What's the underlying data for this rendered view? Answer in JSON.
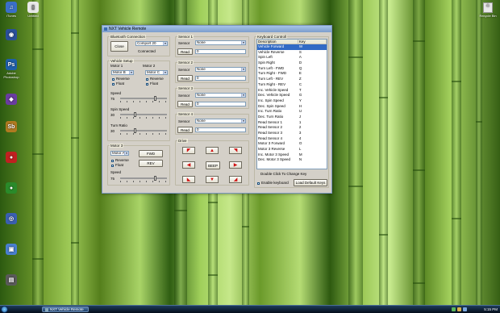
{
  "desktop": {
    "left_icons": [
      "iTunes",
      "",
      "",
      "Adobe Photoshop",
      "",
      "Sb",
      "",
      "",
      "",
      "",
      ""
    ],
    "right_icons": [
      "Recycle Bin"
    ],
    "top_icon_label": "Untitled"
  },
  "taskbar": {
    "task_label": "NXT Vehicle Remote",
    "clock": "5:15 PM"
  },
  "window": {
    "title": "NXT Vehicle Remote"
  },
  "bluetooth": {
    "group_title": "Bluetooth Connection",
    "close_label": "Close",
    "port_value": "Comport 20",
    "status": "Connected"
  },
  "vehicle": {
    "group_title": "Vehicle Setup",
    "motor1_label": "Motor 1",
    "motor2_label": "Motor 2",
    "motor1_value": "Motor B",
    "motor2_value": "Motor C",
    "reverse_label": "Reverse",
    "float_label": "Float",
    "speed_label": "Speed",
    "speed_value": "75",
    "spin_label": "Spin Speed",
    "spin_value": "30",
    "turn_label": "Turn Ratio",
    "turn_value": "30"
  },
  "motor3": {
    "group_title": "Motor 3",
    "motor_value": "Motor A",
    "reverse_label": "Reverse",
    "float_label": "Float",
    "fwd_label": "FWD",
    "rev_label": "REV",
    "speed_label": "Speed",
    "speed_value": "75"
  },
  "sensors": [
    {
      "title": "Sensor 1",
      "sensor_label": "Sensor",
      "type": "None",
      "read_label": "Read",
      "value": "0"
    },
    {
      "title": "Sensor 2",
      "sensor_label": "Sensor",
      "type": "None",
      "read_label": "Read",
      "value": "0"
    },
    {
      "title": "Sensor 3",
      "sensor_label": "Sensor",
      "type": "None",
      "read_label": "Read",
      "value": "0"
    },
    {
      "title": "Sensor 4",
      "sensor_label": "Sensor",
      "type": "None",
      "read_label": "Read",
      "value": "0"
    }
  ],
  "drive": {
    "group_title": "Drive",
    "beep_label": "BEEP"
  },
  "keyboard": {
    "group_title": "Keyboard Controll",
    "col_description": "Description",
    "col_key": "Key",
    "rows": [
      {
        "d": "Vehicle Forward",
        "k": "W"
      },
      {
        "d": "Vehicle Reverse",
        "k": "S"
      },
      {
        "d": "Spin Left",
        "k": "A"
      },
      {
        "d": "Spin Right",
        "k": "D"
      },
      {
        "d": "Turn Left - FWD",
        "k": "Q"
      },
      {
        "d": "Turn Right - FWD",
        "k": "E"
      },
      {
        "d": "Turn Left - REV",
        "k": "Z"
      },
      {
        "d": "Turn Right - REV",
        "k": "C"
      },
      {
        "d": "Inc. Vehicle Speed",
        "k": "T"
      },
      {
        "d": "Dec. Vehicle Speed",
        "k": "G"
      },
      {
        "d": "Inc. Spin Speed",
        "k": "Y"
      },
      {
        "d": "Dec. Spin Speed",
        "k": "H"
      },
      {
        "d": "Inc. Turn Ratio",
        "k": "U"
      },
      {
        "d": "Dec. Turn Ratio",
        "k": "J"
      },
      {
        "d": "Read Sensor 1",
        "k": "1"
      },
      {
        "d": "Read Sensor 2",
        "k": "2"
      },
      {
        "d": "Read Sensor 3",
        "k": "3"
      },
      {
        "d": "Read Sensor 4",
        "k": "4"
      },
      {
        "d": "Motor 3 Forward",
        "k": "O"
      },
      {
        "d": "Motor 3 Reverse",
        "k": "L"
      },
      {
        "d": "Inc. Motor 3 Speed",
        "k": "M"
      },
      {
        "d": "Dec. Motor 3 Speed",
        "k": "N"
      }
    ],
    "hint": "Double Click To Change Key",
    "enable_label": "Enable keyboard",
    "load_default_label": "Load Default Keys"
  }
}
